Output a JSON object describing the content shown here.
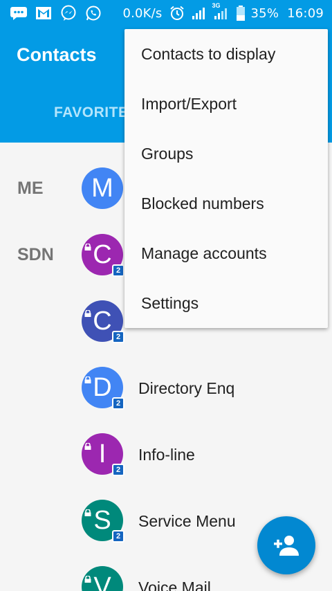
{
  "status_bar": {
    "speed": "0.0K/s",
    "battery": "35%",
    "time": "16:09",
    "network": "3G",
    "icons": [
      "message-icon",
      "gmail-icon",
      "messenger-icon",
      "whatsapp-icon",
      "alarm-icon",
      "signal-icon",
      "signal-3g-icon",
      "battery-icon"
    ]
  },
  "app_bar": {
    "title": "Contacts",
    "tab_label": "FAVORITE"
  },
  "sections": {
    "me": "ME",
    "sdn": "SDN"
  },
  "contacts": [
    {
      "letter": "M",
      "name": "",
      "color": "#4285f4",
      "sim": "",
      "locked": false
    },
    {
      "letter": "C",
      "name": "",
      "color": "#9c27b0",
      "sim": "2",
      "locked": true
    },
    {
      "letter": "C",
      "name": "",
      "color": "#3f51b5",
      "sim": "2",
      "locked": true
    },
    {
      "letter": "D",
      "name": "Directory Enq",
      "color": "#4285f4",
      "sim": "2",
      "locked": true
    },
    {
      "letter": "I",
      "name": "Info-line",
      "color": "#9c27b0",
      "sim": "2",
      "locked": true
    },
    {
      "letter": "S",
      "name": "Service Menu",
      "color": "#00897b",
      "sim": "2",
      "locked": true
    },
    {
      "letter": "V",
      "name": "Voice Mail",
      "color": "#00897b",
      "sim": "2",
      "locked": true
    }
  ],
  "menu": {
    "items": [
      "Contacts to display",
      "Import/Export",
      "Groups",
      "Blocked numbers",
      "Manage accounts",
      "Settings"
    ]
  },
  "fab": {
    "icon": "add-person-icon",
    "color": "#0288d1"
  },
  "colors": {
    "primary": "#039be5",
    "background": "#f5f5f5"
  }
}
